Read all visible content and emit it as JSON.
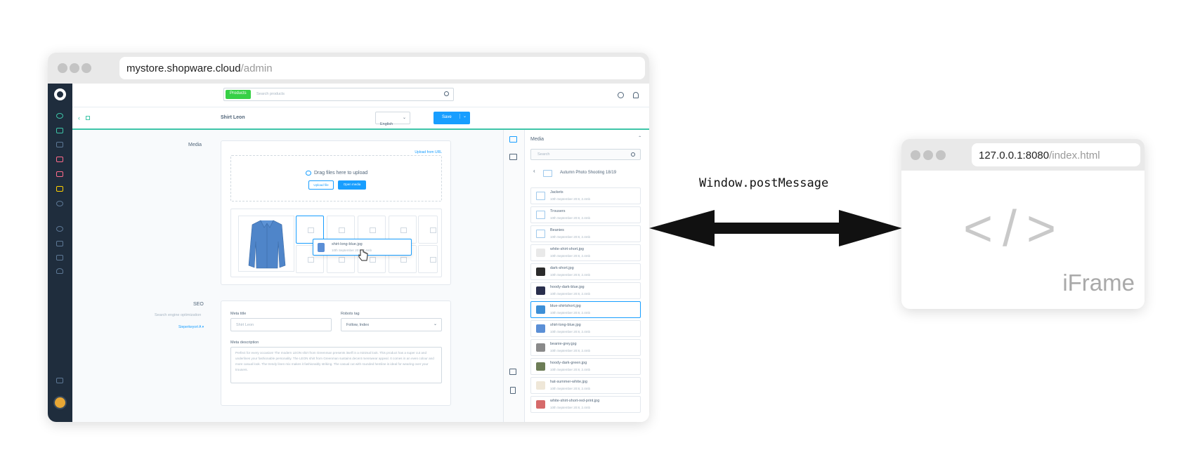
{
  "main_window": {
    "url_host": "mystore.shopware.cloud",
    "url_path": "/admin"
  },
  "topbar": {
    "search_tag": "Products",
    "search_placeholder": "Search products"
  },
  "subbar": {
    "title": "Shirt Leon",
    "language": "English",
    "save_label": "Save"
  },
  "media_section": {
    "label": "Media",
    "upload_url_link": "Upload from URL",
    "drop_text": "Drag files here to upload",
    "upload_button": "Upload file",
    "open_media_button": "Open media",
    "drag_file_name": "shirt-long-blue.jpg",
    "drag_file_meta": "10th September 20:8, 2.4mb"
  },
  "seo_section": {
    "label": "SEO",
    "sublabel": "Search engine optimization",
    "link": "Sieperkeyort A ▾",
    "meta_title_label": "Meta title",
    "meta_title_placeholder": "Shirt Leon",
    "robots_label": "Robots tag",
    "robots_value": "Follow, Index",
    "meta_desc_label": "Meta description",
    "meta_desc_text": "Perfect for every occasion! The modern LEON shirt from Greenman presents itself in a minimal look. This product has a super cut and underlines your fashionable personality. The LEON shirt from Greenman sustains decent menswear appeal. It comes in an even colour and more casual look. The trendy linen mix makes it fashionably striking. The casual cut with rounded hemline is ideal for wearing over your trousers."
  },
  "media_panel": {
    "title": "Media",
    "search_placeholder": "Search",
    "folder": "Autumn Photo Shooting 18/19",
    "items": [
      {
        "name": "Jackets",
        "meta": "10th September 20:8, 2.4mb",
        "kind": "folder"
      },
      {
        "name": "Trousers",
        "meta": "10th September 20:8, 2.4mb",
        "kind": "folder"
      },
      {
        "name": "Beanies",
        "meta": "10th September 20:8, 2.4mb",
        "kind": "folder"
      },
      {
        "name": "white-shirt-short.jpg",
        "meta": "10th September 20:8, 2.4mb",
        "kind": "image",
        "color": "#e9e9e9"
      },
      {
        "name": "dark-short.jpg",
        "meta": "10th September 20:8, 2.4mb",
        "kind": "image",
        "color": "#2b2b2b"
      },
      {
        "name": "hoody-dark-blue.jpg",
        "meta": "10th September 20:8, 2.4mb",
        "kind": "image",
        "color": "#2a2f4d"
      },
      {
        "name": "blue-shirtshort.jpg",
        "meta": "10th September 20:8, 2.4mb",
        "kind": "image",
        "color": "#3d8fd6"
      },
      {
        "name": "shirt-long-blue.jpg",
        "meta": "10th September 20:8, 2.4mb",
        "kind": "image",
        "color": "#5b8fd6"
      },
      {
        "name": "beanie-grey.jpg",
        "meta": "10th September 20:8, 2.4mb",
        "kind": "image",
        "color": "#8a8a8a"
      },
      {
        "name": "hoody-dark-green.jpg",
        "meta": "10th September 20:8, 2.4mb",
        "kind": "image",
        "color": "#6d7d56"
      },
      {
        "name": "hat-summer-white.jpg",
        "meta": "10th September 20:8, 2.4mb",
        "kind": "image",
        "color": "#efe7d8"
      },
      {
        "name": "white-shirt-short-red-print.jpg",
        "meta": "10th September 20:8, 2.4mb",
        "kind": "image",
        "color": "#d66a6a"
      }
    ]
  },
  "arrow_label": "Window.postMessage",
  "iframe_window": {
    "url_host": "127.0.0.1:8080",
    "url_path": "/index.html",
    "code_glyph": "</>",
    "label": "iFrame"
  },
  "colors": {
    "accent": "#189eff",
    "teal": "#3ec5a8",
    "sidebar": "#1f2d3d"
  }
}
